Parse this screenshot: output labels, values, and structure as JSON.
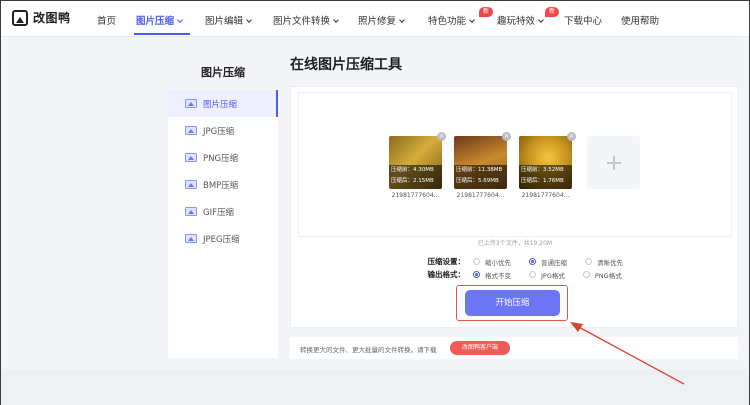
{
  "brand": {
    "name": "改图鸭"
  },
  "nav": {
    "items": [
      {
        "label": "首页"
      },
      {
        "label": "图片压缩",
        "active": true
      },
      {
        "label": "图片编辑"
      },
      {
        "label": "图片文件转换"
      },
      {
        "label": "照片修复"
      },
      {
        "label": "特色功能",
        "badge": "新"
      },
      {
        "label": "趣玩特效",
        "badge": "新"
      },
      {
        "label": "下载中心"
      },
      {
        "label": "使用帮助"
      }
    ]
  },
  "sidebar": {
    "title": "图片压缩",
    "items": [
      {
        "label": "图片压缩",
        "active": true
      },
      {
        "label": "JPG压缩"
      },
      {
        "label": "PNG压缩"
      },
      {
        "label": "BMP压缩"
      },
      {
        "label": "GIF压缩"
      },
      {
        "label": "JPEG压缩"
      }
    ]
  },
  "main": {
    "title": "在线图片压缩工具",
    "files": [
      {
        "name": "21981777604...",
        "before_label": "压缩前：",
        "before": "4.30MB",
        "after_label": "压缩后：",
        "after": "2.15MB",
        "color_a": "#8a6a20",
        "color_b": "#d6ad3a"
      },
      {
        "name": "21981777604...",
        "before_label": "压缩前：",
        "before": "11.38MB",
        "after_label": "压缩后：",
        "after": "5.69MB",
        "color_a": "#6b3a1c",
        "color_b": "#c98a2c"
      },
      {
        "name": "21981777604...",
        "before_label": "压缩前：",
        "before": "3.52MB",
        "after_label": "压缩后：",
        "after": "1.76MB",
        "color_a": "#7a5a12",
        "color_b": "#e8b83a"
      }
    ],
    "upload_info": "已上传3个文件，共19.20M",
    "settings": {
      "compress_label": "压缩设置：",
      "compress_options": [
        {
          "label": "缩小优先",
          "selected": false
        },
        {
          "label": "普通压缩",
          "selected": true
        },
        {
          "label": "清晰优先",
          "selected": false
        }
      ],
      "format_label": "输出格式：",
      "format_options": [
        {
          "label": "格式不变",
          "selected": true
        },
        {
          "label": "JPG格式",
          "selected": false
        },
        {
          "label": "PNG格式",
          "selected": false
        }
      ]
    },
    "start_button": "开始压缩"
  },
  "bottom": {
    "text": "转换更大的文件、更大批量的文件转换，请下载",
    "client_button": "改图鸭客户端"
  },
  "colors": {
    "accent": "#4e5cf0",
    "button": "#6c76f4",
    "highlight": "#e05a4a",
    "client": "#f05b55"
  }
}
